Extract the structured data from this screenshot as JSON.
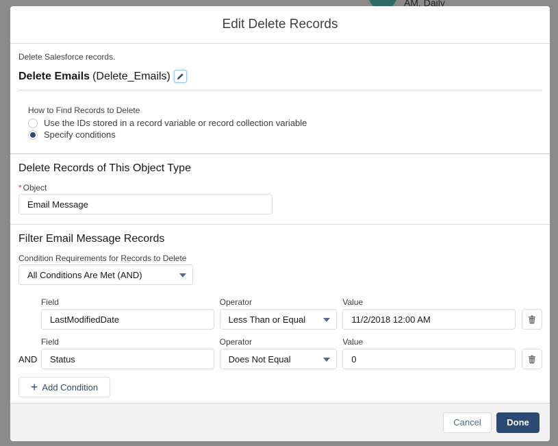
{
  "background": {
    "partial_text": "AM, Daily"
  },
  "modal": {
    "title": "Edit Delete Records",
    "description": "Delete Salesforce records.",
    "element_label": "Delete Emails",
    "element_api_name": "(Delete_Emails)",
    "find_records": {
      "legend": "How to Find Records to Delete",
      "options": [
        {
          "label": "Use the IDs stored in a record variable or record collection variable",
          "checked": false
        },
        {
          "label": "Specify conditions",
          "checked": true
        }
      ]
    },
    "object_section": {
      "title": "Delete Records of This Object Type",
      "object_label": "Object",
      "required_marker": "*",
      "object_value": "Email Message"
    },
    "filter_section": {
      "title": "Filter Email Message Records",
      "condition_requirements_label": "Condition Requirements for Records to Delete",
      "condition_requirements_value": "All Conditions Are Met (AND)",
      "field_label": "Field",
      "operator_label": "Operator",
      "value_label": "Value",
      "conditions": [
        {
          "prefix": "",
          "field": "LastModifiedDate",
          "operator": "Less Than or Equal",
          "value": "11/2/2018 12:00 AM"
        },
        {
          "prefix": "AND",
          "field": "Status",
          "operator": "Does Not Equal",
          "value": "0"
        }
      ],
      "add_condition_label": "Add Condition"
    },
    "footer": {
      "cancel_label": "Cancel",
      "done_label": "Done"
    }
  },
  "colors": {
    "brand": "#2a4a73",
    "required": "#c23934"
  }
}
